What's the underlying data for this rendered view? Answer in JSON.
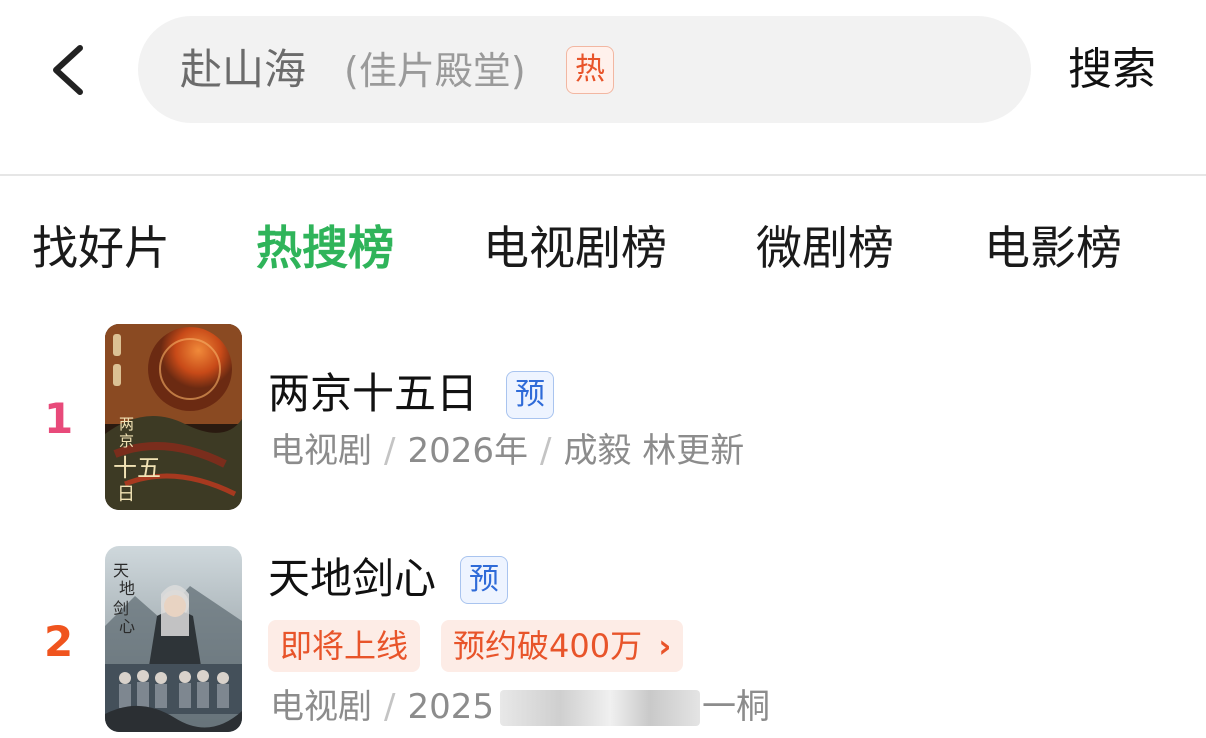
{
  "search": {
    "query_main": "赴山海",
    "query_sub": "(佳片殿堂)",
    "hot_badge": "热",
    "submit_label": "搜索"
  },
  "tabs": [
    {
      "label": "找好片",
      "active": false
    },
    {
      "label": "热搜榜",
      "active": true
    },
    {
      "label": "电视剧榜",
      "active": false
    },
    {
      "label": "微剧榜",
      "active": false
    },
    {
      "label": "电影榜",
      "active": false
    }
  ],
  "rankings": [
    {
      "rank": "1",
      "rank_color": "#e84a7a",
      "title": "两京十五日",
      "badge": "预",
      "poster_text": "两京十五日",
      "meta": {
        "genre": "电视剧",
        "sep": "/",
        "year": "2026年",
        "cast": "成毅 林更新"
      }
    },
    {
      "rank": "2",
      "rank_color": "#f0541e",
      "title": "天地剑心",
      "badge": "预",
      "poster_text": "天地剑心",
      "tags": [
        "即将上线",
        "预约破400万"
      ],
      "tag_chevron": "›",
      "meta": {
        "genre": "电视剧",
        "sep": "/",
        "year": "2025",
        "cast_tail": "一桐"
      }
    }
  ],
  "colors": {
    "accent_green": "#2fb45a",
    "hot_orange": "#e8542a",
    "pre_blue": "#2f6bd8"
  }
}
